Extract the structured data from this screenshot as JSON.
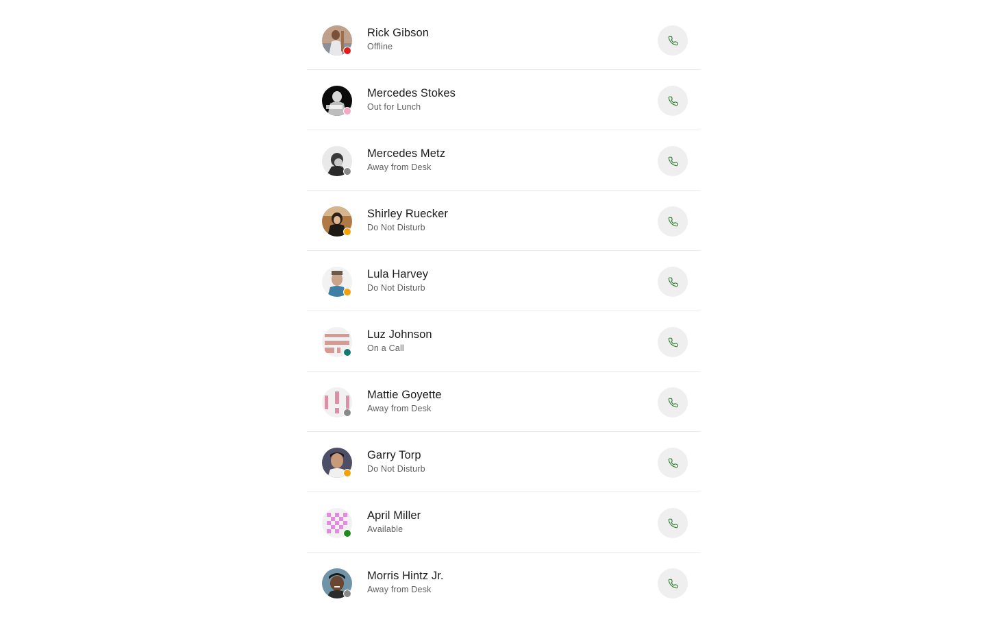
{
  "colors": {
    "call_icon": "#2e7d32",
    "call_button_bg": "#efefef",
    "status_offline": "#e41b1b",
    "status_lunch": "#f4a9c0",
    "status_away": "#8a8a8a",
    "status_dnd": "#f5a20a",
    "status_on_call": "#117a74",
    "status_available": "#1f8a1f"
  },
  "contacts": [
    {
      "name": "Rick Gibson",
      "status": "Offline",
      "status_color": "#e41b1b",
      "avatar_icon": "person-photo-avatar",
      "call_icon": "phone-icon"
    },
    {
      "name": "Mercedes Stokes",
      "status": "Out for Lunch",
      "status_color": "#f4a9c0",
      "avatar_icon": "person-photo-avatar",
      "call_icon": "phone-icon"
    },
    {
      "name": "Mercedes Metz",
      "status": "Away from Desk",
      "status_color": "#8a8a8a",
      "avatar_icon": "person-photo-avatar",
      "call_icon": "phone-icon"
    },
    {
      "name": "Shirley Ruecker",
      "status": "Do Not Disturb",
      "status_color": "#f5a20a",
      "avatar_icon": "person-photo-avatar",
      "call_icon": "phone-icon"
    },
    {
      "name": "Lula Harvey",
      "status": "Do Not Disturb",
      "status_color": "#f5a20a",
      "avatar_icon": "person-photo-avatar",
      "call_icon": "phone-icon"
    },
    {
      "name": "Luz Johnson",
      "status": "On a Call",
      "status_color": "#117a74",
      "avatar_icon": "identicon-avatar",
      "call_icon": "phone-icon"
    },
    {
      "name": "Mattie Goyette",
      "status": "Away from Desk",
      "status_color": "#8a8a8a",
      "avatar_icon": "identicon-avatar",
      "call_icon": "phone-icon"
    },
    {
      "name": "Garry Torp",
      "status": "Do Not Disturb",
      "status_color": "#f5a20a",
      "avatar_icon": "person-photo-avatar",
      "call_icon": "phone-icon"
    },
    {
      "name": "April Miller",
      "status": "Available",
      "status_color": "#1f8a1f",
      "avatar_icon": "identicon-avatar",
      "call_icon": "phone-icon"
    },
    {
      "name": "Morris Hintz Jr.",
      "status": "Away from Desk",
      "status_color": "#8a8a8a",
      "avatar_icon": "person-photo-avatar",
      "call_icon": "phone-icon"
    }
  ]
}
